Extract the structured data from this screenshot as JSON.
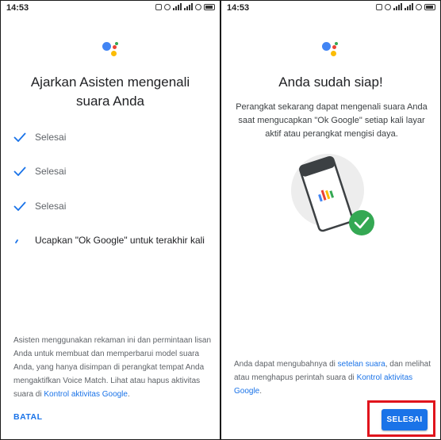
{
  "colors": {
    "accent": "#1a73e8",
    "highlight_box": "#e0141c",
    "success": "#34a853"
  },
  "left": {
    "status_time": "14:53",
    "title": "Ajarkan Asisten mengenali suara Anda",
    "steps": [
      {
        "label": "Selesai",
        "state": "done"
      },
      {
        "label": "Selesai",
        "state": "done"
      },
      {
        "label": "Selesai",
        "state": "done"
      },
      {
        "label": "Ucapkan \"Ok Google\" untuk terakhir kali",
        "state": "active"
      }
    ],
    "info_text": "Asisten menggunakan rekaman ini dan permintaan lisan Anda untuk membuat dan memperbarui model suara Anda, yang hanya disimpan di perangkat tempat Anda mengaktifkan Voice Match. Lihat atau hapus aktivitas suara di ",
    "info_link": "Kontrol aktivitas Google",
    "info_end": ".",
    "cancel_label": "BATAL"
  },
  "right": {
    "status_time": "14:53",
    "title": "Anda sudah siap!",
    "subtitle": "Perangkat sekarang dapat mengenali suara Anda saat mengucapkan \"Ok Google\" setiap kali layar aktif atau perangkat mengisi daya.",
    "info_text_1": "Anda dapat mengubahnya di ",
    "info_link_1": "setelan suara",
    "info_text_2": ", dan melihat atau menghapus perintah suara di ",
    "info_link_2": "Kontrol aktivitas Google",
    "info_end": ".",
    "done_label": "SELESAI"
  }
}
